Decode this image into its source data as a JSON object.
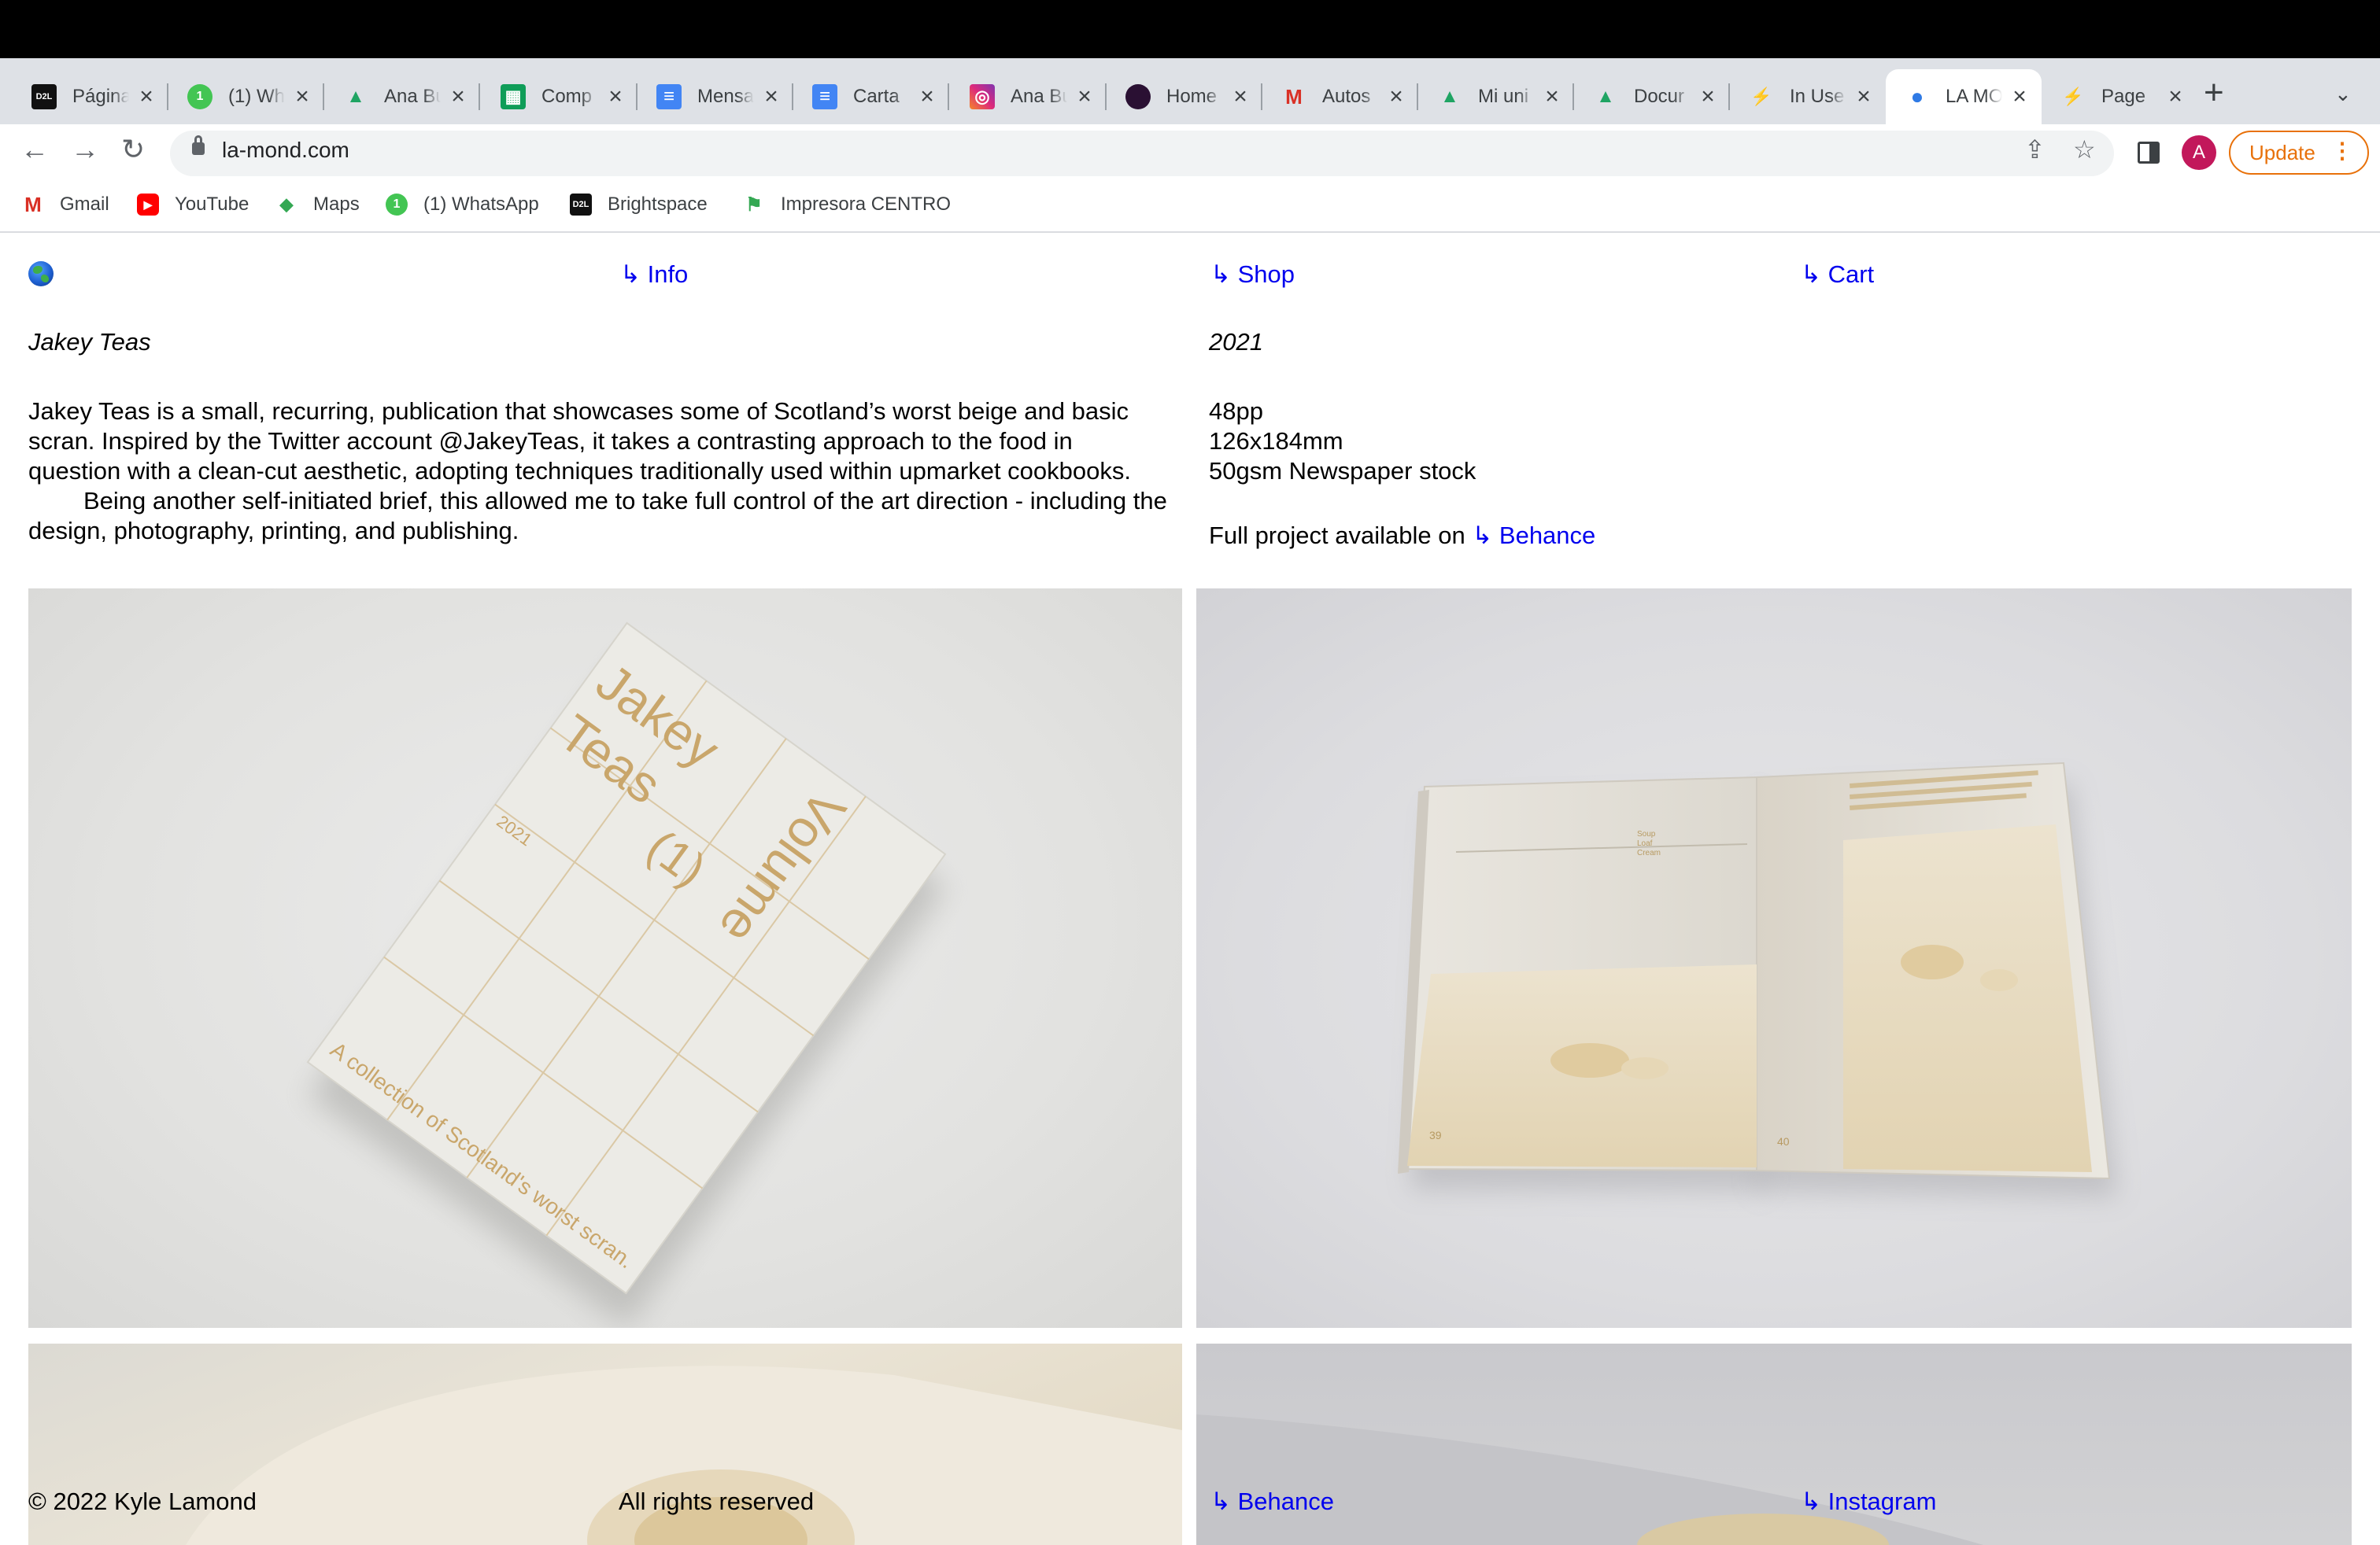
{
  "browser": {
    "tabs": [
      {
        "title": "Página",
        "favicon": "d2l-icon",
        "active": false
      },
      {
        "title": "(1) Wh",
        "favicon": "whatsapp-icon",
        "active": false
      },
      {
        "title": "Ana Bu",
        "favicon": "google-drive-icon",
        "active": false
      },
      {
        "title": "Comp",
        "favicon": "google-sheets-icon",
        "active": false
      },
      {
        "title": "Mensa",
        "favicon": "google-docs-icon",
        "active": false
      },
      {
        "title": "Carta",
        "favicon": "google-docs-icon",
        "active": false
      },
      {
        "title": "Ana Bu",
        "favicon": "instagram-icon",
        "active": false
      },
      {
        "title": "Home",
        "favicon": "dark-circle-icon",
        "active": false
      },
      {
        "title": "Autos",
        "favicon": "gmail-icon",
        "active": false
      },
      {
        "title": "Mi uni",
        "favicon": "google-drive-icon",
        "active": false
      },
      {
        "title": "Docur",
        "favicon": "google-drive-icon",
        "active": false
      },
      {
        "title": "In Use",
        "favicon": "bolt-icon",
        "active": false
      },
      {
        "title": "LA MO",
        "favicon": "globe-icon",
        "active": true
      },
      {
        "title": "Page",
        "favicon": "bolt-icon",
        "active": false
      }
    ],
    "url": "la-mond.com",
    "update_label": "Update",
    "avatar_initial": "A",
    "bookmarks": [
      {
        "label": "Gmail",
        "icon": "gmail-icon"
      },
      {
        "label": "YouTube",
        "icon": "youtube-icon"
      },
      {
        "label": "Maps",
        "icon": "maps-icon"
      },
      {
        "label": "(1) WhatsApp",
        "icon": "whatsapp-icon"
      },
      {
        "label": "Brightspace",
        "icon": "d2l-icon"
      },
      {
        "label": "Impresora CENTRO",
        "icon": "flag-icon"
      }
    ]
  },
  "site": {
    "nav": {
      "home_icon": "globe-icon",
      "info": "↳ Info",
      "shop": "↳ Shop",
      "cart": "↳ Cart"
    },
    "project": {
      "title": "Jakey Teas",
      "year": "2021",
      "description_p1": "Jakey Teas is a small, recurring, publication that showcases some of Scotland’s worst beige and basic scran. Inspired by the Twitter account @JakeyTeas, it takes a contrasting approach to the food in question with a clean-cut aesthetic, adopting techniques traditionally used within upmarket cookbooks.",
      "description_p2": "Being another self-initiated brief, this allowed me to take full control of the art direction - including the design, photography, printing, and publishing.",
      "specs": [
        "48pp",
        "126x184mm",
        "50gsm Newspaper stock"
      ],
      "full_project_prefix": "Full project available on",
      "full_project_link": "↳ Behance"
    },
    "cover": {
      "title_line1": "Jakey",
      "title_line2": "Teas",
      "issue": "(1)",
      "volume": "Volume",
      "year": "2021",
      "tagline": "A collection of Scotland's worst scran."
    },
    "spread": {
      "heading_lines": [
        "Soup",
        "Loaf",
        "Cream"
      ],
      "page_left": "39",
      "page_right": "40"
    },
    "footer": {
      "copyright": "© 2022 Kyle Lamond",
      "rights": "All rights reserved",
      "behance": "↳ Behance",
      "instagram": "↳ Instagram"
    }
  },
  "colors": {
    "link": "#0000ee",
    "print_ochre": "#c9a66b",
    "update_orange": "#e8710a",
    "active_tab": "#ffffff",
    "tabstrip": "#dee1e6"
  }
}
